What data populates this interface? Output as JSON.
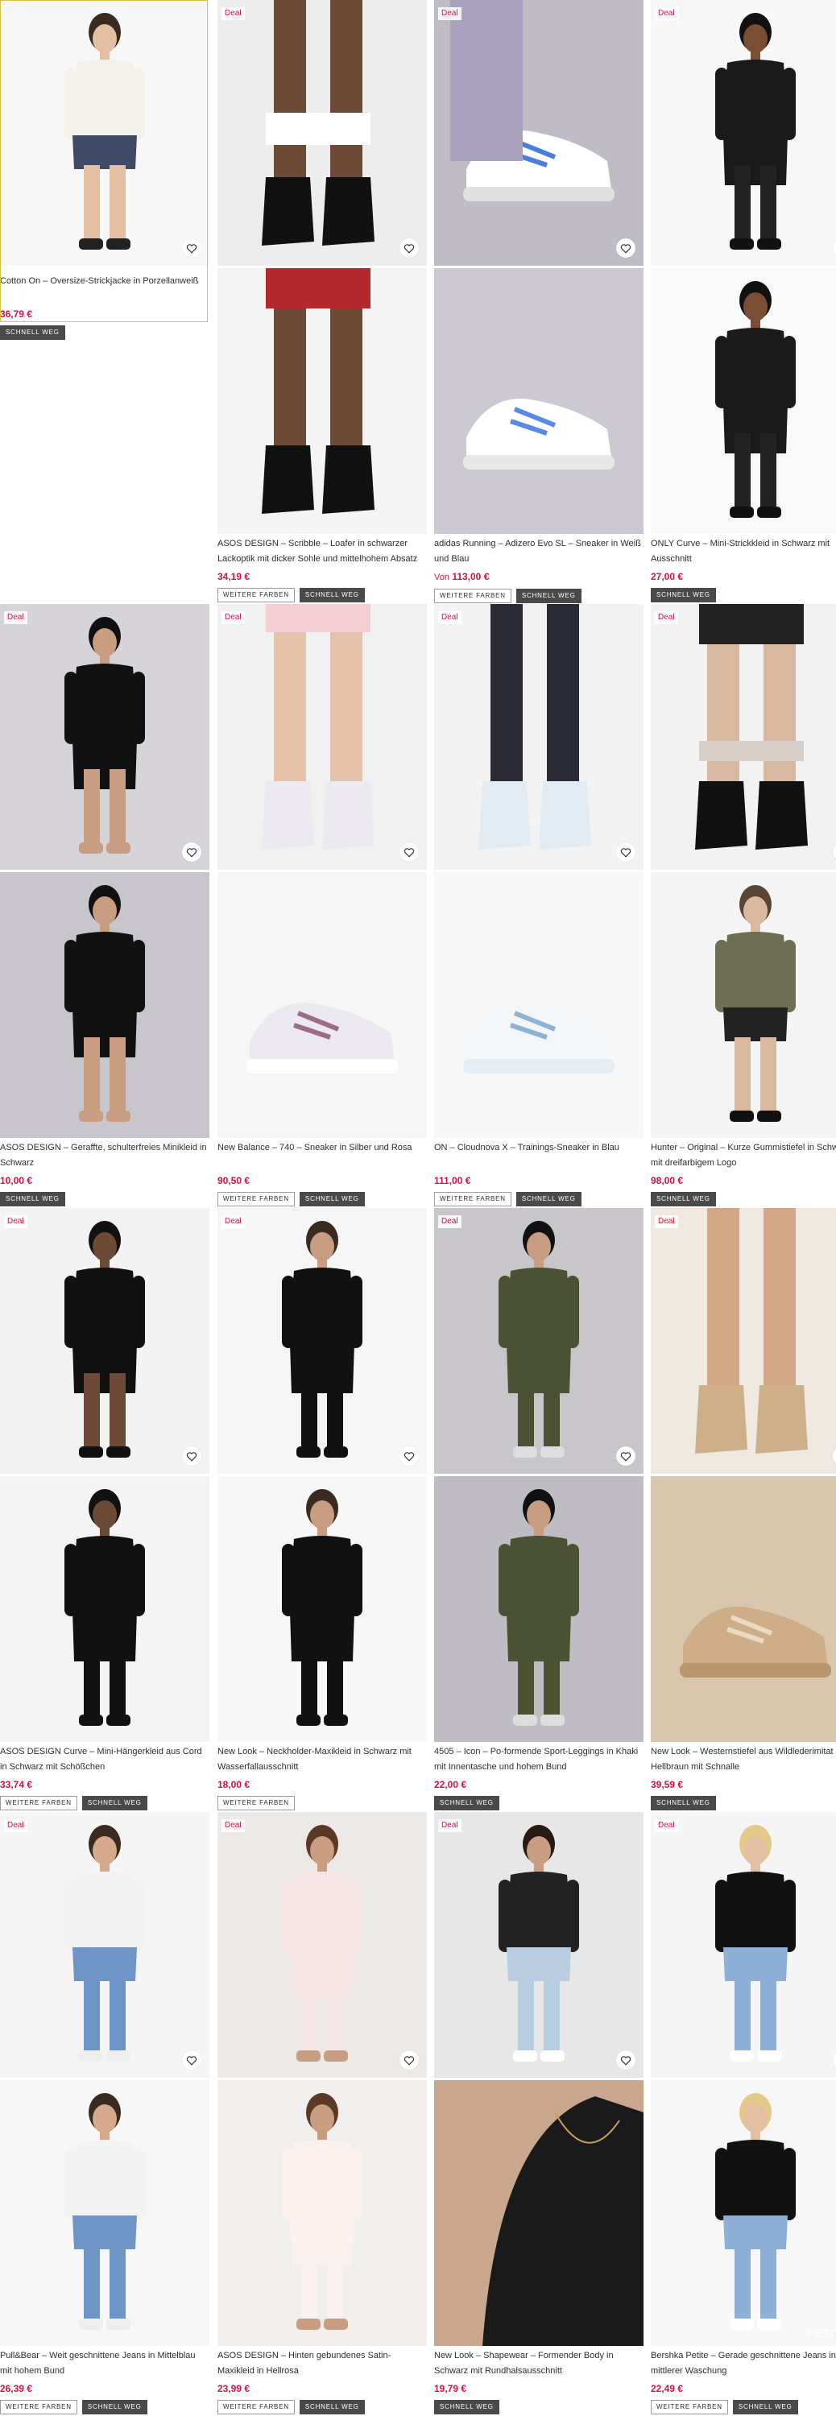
{
  "labels": {
    "deal": "Deal",
    "more_colors": "WEITERE FARBEN",
    "fast_sell": "SCHNELL WEG",
    "petite": "PETITE",
    "from": "Von"
  },
  "icons": {
    "wishlist": "heart-icon"
  },
  "colors": {
    "price": "#d01345",
    "deal": "#d01345",
    "fast_tag_bg": "#4a4a4a",
    "selected_border": "#d9c150"
  },
  "products": [
    {
      "title": "Cotton On – Oversize-Strickjacke in Porzellanweiß",
      "price": "36,79 €",
      "deal": false,
      "more_colors": false,
      "fast": true
    },
    {
      "title": "ASOS DESIGN – Scribble – Loafer in schwarzer Lackoptik mit dicker Sohle und mittelhohem Absatz",
      "price": "34,19 €",
      "deal": true,
      "more_colors": true,
      "fast": true
    },
    {
      "title": "adidas Running – Adizero Evo SL – Sneaker in Weiß und Blau",
      "price": "113,00 €",
      "from": true,
      "deal": true,
      "more_colors": true,
      "fast": true
    },
    {
      "title": "ONLY Curve – Mini-Strickkleid in Schwarz mit Ausschnitt",
      "price": "27,00 €",
      "deal": true,
      "more_colors": false,
      "fast": true
    },
    {
      "title": "ASOS DESIGN – Geraffte, schulterfreies Minikleid in Schwarz",
      "price": "10,00 €",
      "deal": true,
      "more_colors": false,
      "fast": true
    },
    {
      "title": "New Balance – 740 – Sneaker in Silber und Rosa",
      "price": "90,50 €",
      "deal": true,
      "more_colors": true,
      "fast": true
    },
    {
      "title": "ON – Cloudnova X – Trainings-Sneaker in Blau",
      "price": "111,00 €",
      "deal": true,
      "more_colors": true,
      "fast": true
    },
    {
      "title": "Hunter – Original – Kurze Gummistiefel in Schwarz mit dreifarbigem Logo",
      "price": "98,00 €",
      "deal": true,
      "more_colors": false,
      "fast": true
    },
    {
      "title": "ASOS DESIGN Curve – Mini-Hängerkleid aus Cord in Schwarz mit Schößchen",
      "price": "33,74 €",
      "deal": true,
      "more_colors": true,
      "fast": true
    },
    {
      "title": "New Look – Neckholder-Maxikleid in Schwarz mit Wasserfallausschnitt",
      "price": "18,00 €",
      "deal": true,
      "more_colors": true,
      "fast": false
    },
    {
      "title": "4505 – Icon – Po-formende Sport-Leggings in Khaki mit Innentasche und hohem Bund",
      "price": "22,00 €",
      "deal": true,
      "more_colors": false,
      "fast": true
    },
    {
      "title": "New Look – Westernstiefel aus Wildlederimitat in Hellbraun mit Schnalle",
      "price": "39,59 €",
      "deal": true,
      "more_colors": false,
      "fast": true
    },
    {
      "title": "Pull&Bear – Weit geschnittene Jeans in Mittelblau mit hohem Bund",
      "price": "26,39 €",
      "deal": true,
      "more_colors": true,
      "fast": true
    },
    {
      "title": "ASOS DESIGN – Hinten gebundenes Satin-Maxikleid in Hellrosa",
      "price": "23,99 €",
      "deal": true,
      "more_colors": true,
      "fast": true
    },
    {
      "title": "New Look – Shapewear – Formender Body in Schwarz mit Rundhalsausschnitt",
      "price": "19,79 €",
      "deal": true,
      "more_colors": false,
      "fast": true
    },
    {
      "title": "Bershka Petite – Gerade geschnittene Jeans in mittlerer Waschung",
      "price": "22,49 €",
      "deal": true,
      "more_colors": true,
      "fast": true,
      "petite": true
    }
  ]
}
